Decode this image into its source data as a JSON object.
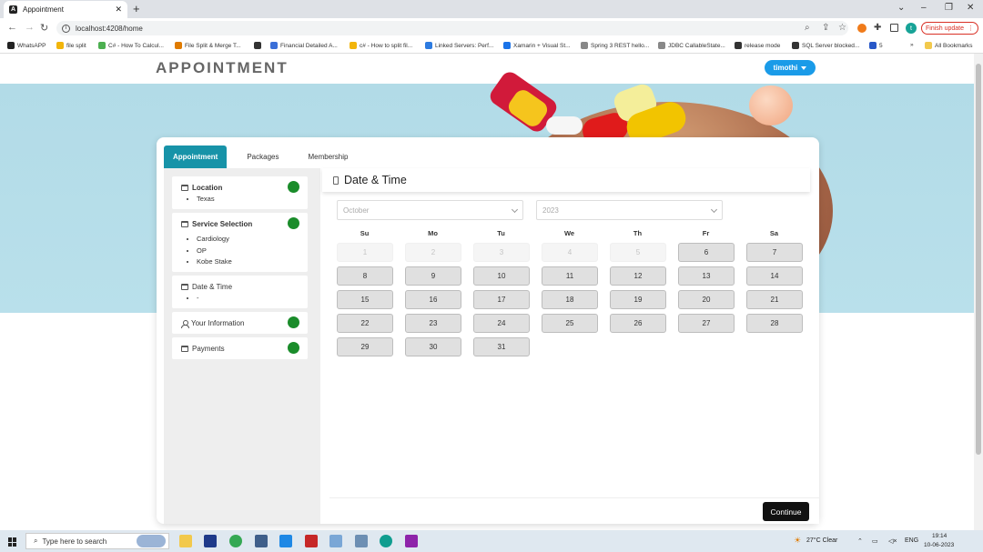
{
  "browser": {
    "tab_title": "Appointment",
    "url": "localhost:4208/home",
    "finish_update": "Finish update",
    "profile_initial": "t",
    "bookmarks": [
      {
        "label": "WhatsAPP",
        "color": "#222"
      },
      {
        "label": "file split",
        "color": "#f2b50b"
      },
      {
        "label": "C# - How To Calcul...",
        "color": "#4caf50"
      },
      {
        "label": "File Split & Merge T...",
        "color": "#e07b00"
      },
      {
        "label": "",
        "color": "#333"
      },
      {
        "label": "Financial Detailed A...",
        "color": "#3a6fd8"
      },
      {
        "label": "c# - How to split fil...",
        "color": "#f2b50b"
      },
      {
        "label": "Linked Servers: Perf...",
        "color": "#2d7be0"
      },
      {
        "label": "Xamarin + Visual St...",
        "color": "#1a73e8"
      },
      {
        "label": "Spring 3 REST hello...",
        "color": "#888"
      },
      {
        "label": "JDBC CallableState...",
        "color": "#888"
      },
      {
        "label": "release mode",
        "color": "#333"
      },
      {
        "label": "SQL Server blocked...",
        "color": "#333"
      },
      {
        "label": "5",
        "color": "#2757c7"
      }
    ],
    "all_bookmarks": "All Bookmarks"
  },
  "header": {
    "title": "APPOINTMENT",
    "user": "timothi"
  },
  "tabs": [
    "Appointment",
    "Packages",
    "Membership"
  ],
  "sidebar": {
    "location": {
      "label": "Location",
      "items": [
        "Texas"
      ]
    },
    "service": {
      "label": "Service Selection",
      "items": [
        "Cardiology",
        "OP",
        "Kobe Stake"
      ]
    },
    "datetime": {
      "label": "Date & Time",
      "items": [
        "-"
      ]
    },
    "info": {
      "label": "Your Information"
    },
    "payments": {
      "label": "Payments"
    }
  },
  "main": {
    "title": "Date & Time",
    "month": "October",
    "year": "2023",
    "weekdays": [
      "Su",
      "Mo",
      "Tu",
      "We",
      "Th",
      "Fr",
      "Sa"
    ],
    "days": [
      "1",
      "2",
      "3",
      "4",
      "5",
      "6",
      "7",
      "8",
      "9",
      "10",
      "11",
      "12",
      "13",
      "14",
      "15",
      "16",
      "17",
      "18",
      "19",
      "20",
      "21",
      "22",
      "23",
      "24",
      "25",
      "26",
      "27",
      "28",
      "29",
      "30",
      "31"
    ],
    "disabled_count": 5,
    "continue": "Continue"
  },
  "taskbar": {
    "search_placeholder": "Type here to search",
    "weather": "27°C Clear",
    "lang": "ENG",
    "time": "19:14",
    "date": "10-06-2023"
  },
  "colors": {
    "accent": "#1793a8",
    "button_blue": "#1a9be8",
    "status_green": "#1a8c2a"
  }
}
